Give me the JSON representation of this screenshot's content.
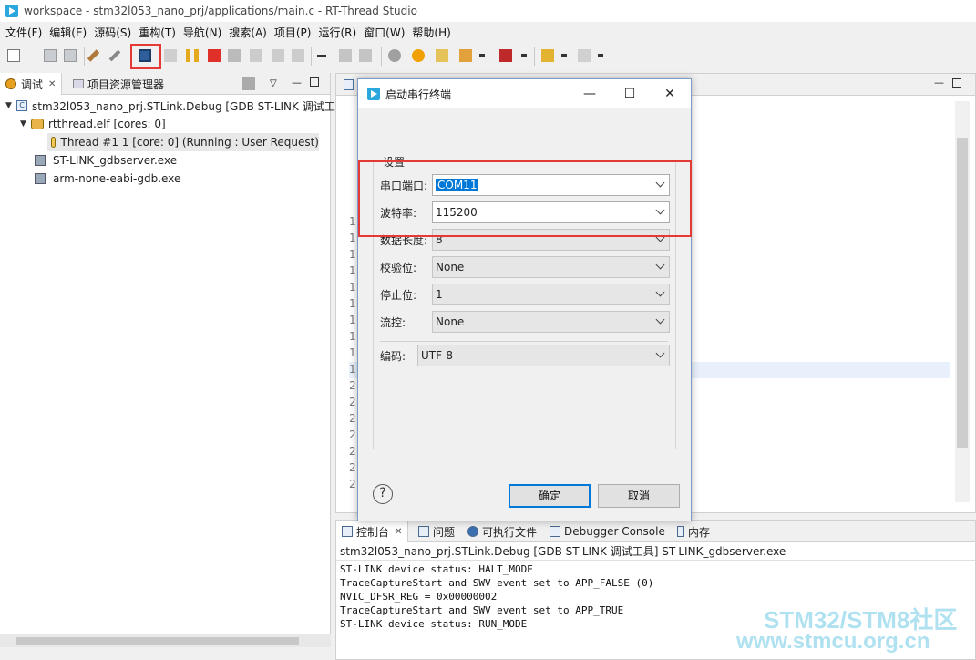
{
  "window": {
    "title": "workspace - stm32l053_nano_prj/applications/main.c - RT-Thread Studio"
  },
  "menu": [
    "文件(F)",
    "编辑(E)",
    "源码(S)",
    "重构(T)",
    "导航(N)",
    "搜索(A)",
    "项目(P)",
    "运行(R)",
    "窗口(W)",
    "帮助(H)"
  ],
  "debug_view": {
    "tab_label": "调试",
    "tab2_label": "项目资源管理器",
    "tree": [
      {
        "label": "stm32l053_nano_prj.STLink.Debug [GDB ST-LINK 调试工"
      },
      {
        "label": "rtthread.elf [cores: 0]"
      },
      {
        "label": "Thread #1 1 [core: 0] (Running : User Request)"
      },
      {
        "label": "ST-LINK_gdbserver.exe"
      },
      {
        "label": "arm-none-eabi-gdb.exe"
      }
    ]
  },
  "editor": {
    "line_numbers": [
      "1",
      "1",
      "1",
      "1",
      "1",
      "1",
      "1",
      "1",
      "1",
      "1",
      "2",
      "2",
      "2",
      "2",
      "2",
      "2",
      "2"
    ]
  },
  "console": {
    "tabs": [
      "控制台",
      "问题",
      "可执行文件",
      "Debugger Console",
      "内存"
    ],
    "header": "stm32l053_nano_prj.STLink.Debug [GDB ST-LINK 调试工具] ST-LINK_gdbserver.exe",
    "lines": [
      "ST-LINK device status: HALT_MODE",
      "TraceCaptureStart and SWV event set to APP_FALSE (0)",
      "NVIC_DFSR_REG = 0x00000002",
      "TraceCaptureStart and SWV event set to APP_TRUE",
      "ST-LINK device status: RUN_MODE"
    ]
  },
  "dialog": {
    "title": "启动串行终端",
    "group_label": "设置",
    "fields": {
      "port": {
        "label": "串口端口:",
        "value": "COM11"
      },
      "baud": {
        "label": "波特率:",
        "value": "115200"
      },
      "data_bits": {
        "label": "数据长度:",
        "value": "8"
      },
      "parity": {
        "label": "校验位:",
        "value": "None"
      },
      "stop_bits": {
        "label": "停止位:",
        "value": "1"
      },
      "flow": {
        "label": "流控:",
        "value": "None"
      },
      "encoding": {
        "label": "编码:",
        "value": "UTF-8"
      }
    },
    "ok_label": "确定",
    "cancel_label": "取消",
    "help_glyph": "?"
  },
  "watermark": {
    "line1": "STM32/STM8社区",
    "line2": "www.stmcu.org.cn"
  },
  "colors": {
    "accent": "#0078d7",
    "highlight": "#e53935"
  }
}
